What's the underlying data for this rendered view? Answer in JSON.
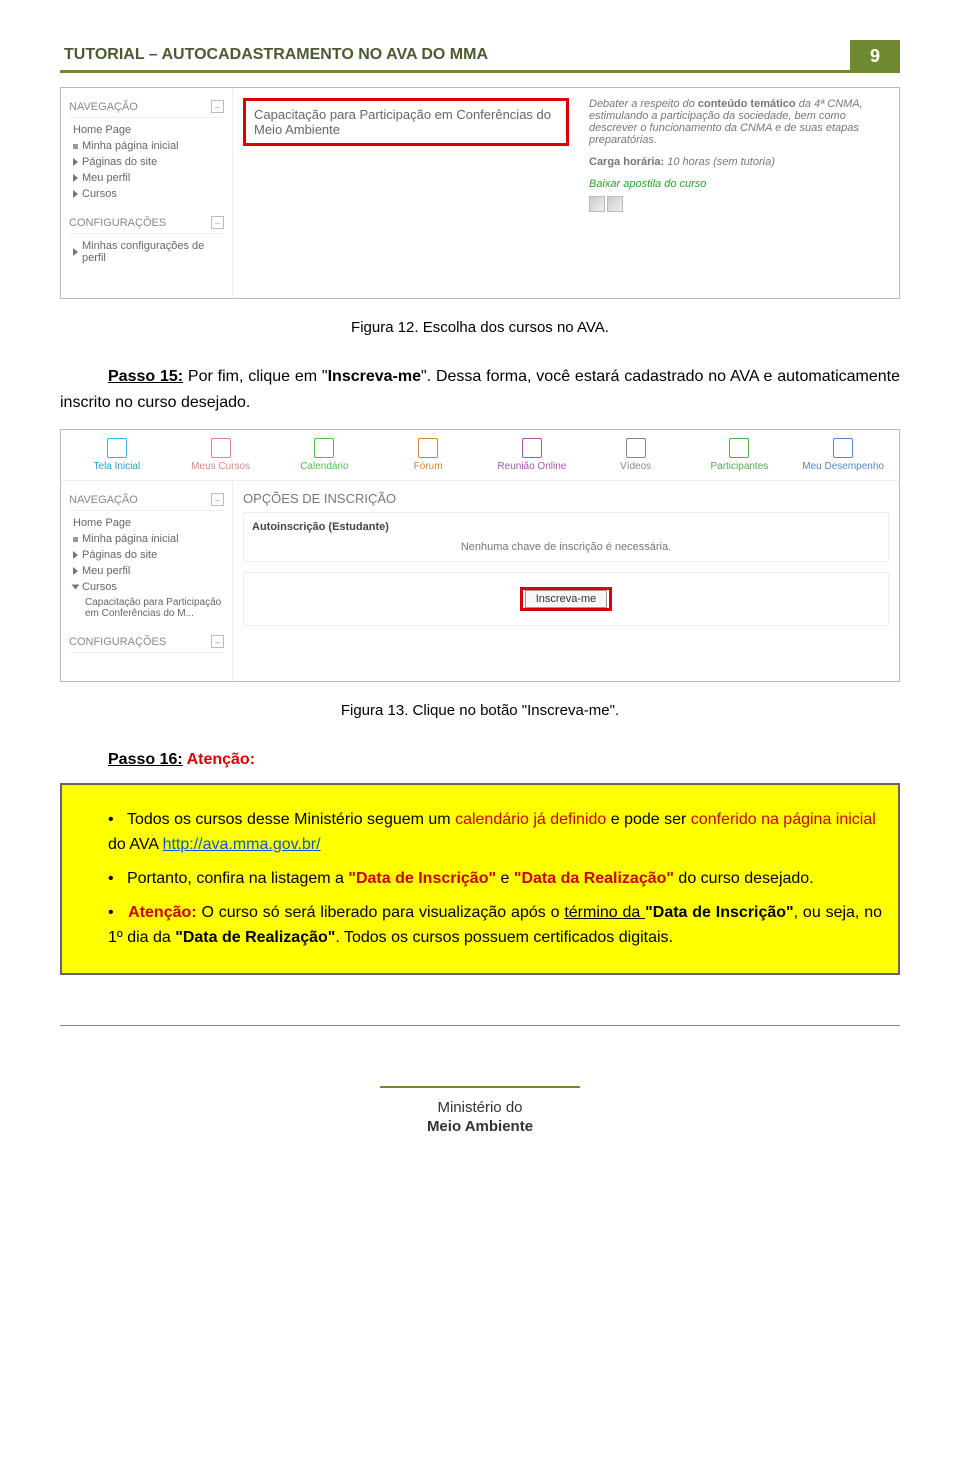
{
  "header": {
    "title": "TUTORIAL – AUTOCADASTRAMENTO NO AVA DO MMA",
    "page_num": "9"
  },
  "ss1": {
    "nav_head": "NAVEGAÇÃO",
    "nav_items": [
      "Home Page",
      "Minha página inicial",
      "Páginas do site",
      "Meu perfil",
      "Cursos"
    ],
    "conf_head": "CONFIGURAÇÕES",
    "conf_item": "Minhas configurações de perfil",
    "course_title": "Capacitação para Participação em Conferências do Meio Ambiente",
    "desc_pre": "Debater a respeito do ",
    "desc_bold": "conteúdo temático",
    "desc_post": " da 4ª CNMA, estimulando a participação da sociedade, bem como descrever o funcionamento da CNMA e de suas etapas preparatórias.",
    "carga_label": "Carga horária:",
    "carga_val": " 10 horas (sem tutoria)",
    "baixar": "Baixar apostila do curso"
  },
  "caption1": "Figura 12. Escolha dos cursos no AVA.",
  "passo15": {
    "label": "Passo 15:",
    "t1": " Por fim, clique em \"",
    "bold": "Inscreva-me",
    "t2": "\". Dessa forma, você estará cadastrado no AVA e automaticamente inscrito no curso desejado."
  },
  "ss2": {
    "toolbar": [
      "Tela Inicial",
      "Meus Cursos",
      "Calendário",
      "Fórum",
      "Reunião Online",
      "Vídeos",
      "Participantes",
      "Meu Desempenho"
    ],
    "nav_head": "NAVEGAÇÃO",
    "n_items": [
      "Home Page",
      "Minha página inicial",
      "Páginas do site",
      "Meu perfil",
      "Cursos",
      "Capacitação para Participação em Conferências do M..."
    ],
    "conf_head": "CONFIGURAÇÕES",
    "opt_title": "OPÇÕES DE INSCRIÇÃO",
    "auto_title": "Autoinscrição (Estudante)",
    "no_key": "Nenhuma chave de inscrição é necessária.",
    "btn": "Inscreva-me"
  },
  "caption2": "Figura 13. Clique no botão \"Inscreva-me\".",
  "passo16": {
    "label": "Passo 16:",
    "at": " Atenção:"
  },
  "yb": {
    "l1a": "Todos os cursos desse Ministério seguem um ",
    "l1b": "calendário já definido",
    "l1c": " e pode ser ",
    "l1d": "conferido na página inicial",
    "l1e": " do AVA ",
    "url": "http://ava.mma.gov.br/",
    "l2a": "Portanto, confira na listagem a ",
    "l2b": "\"Data de Inscrição\"",
    "l2c": " e ",
    "l2d": "\"Data da Realização\"",
    "l2e": " do curso desejado.",
    "l3a": "Atenção:",
    "l3b": " O curso só será liberado para visualização após o ",
    "l3c": "término da ",
    "l3d": "\"Data de Inscrição\"",
    "l3e": ", ou seja, no 1º dia da ",
    "l3f": "\"Data de Realização\"",
    "l3g": ". Todos os cursos possuem certificados digitais."
  },
  "footer": {
    "l1": "Ministério do",
    "l2": "Meio Ambiente"
  }
}
